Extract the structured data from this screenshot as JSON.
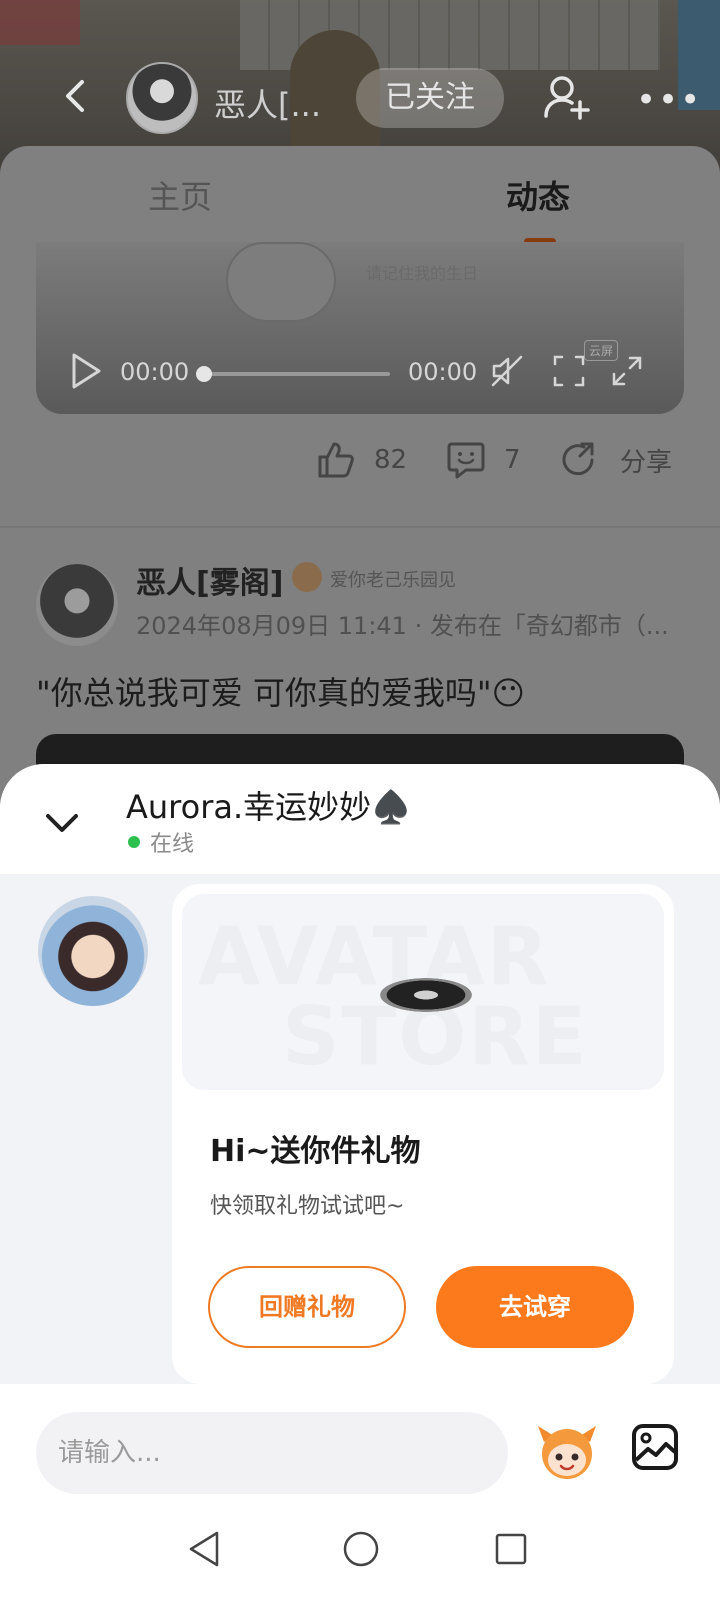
{
  "header": {
    "user_name": "恶人[...",
    "follow_label": "已关注"
  },
  "tabs": [
    {
      "label": "主页"
    },
    {
      "label": "动态"
    }
  ],
  "video": {
    "caption": "请记住我的生日",
    "cc_badge": "云屏",
    "time_current": "00:00",
    "time_total": "00:00",
    "progress": 0
  },
  "actions": {
    "likes": "82",
    "comments": "7",
    "share_label": "分享"
  },
  "post": {
    "author": "恶人[雾阁]",
    "badge_text": "爱你老己乐园见",
    "meta": "2024年08月09日 11:41 · 发布在「奇幻都市（...",
    "text": "\"你总说我可爱  可你真的爱我吗\"😶"
  },
  "chat": {
    "title": "Aurora.幸运妙妙♠️",
    "status": "在线",
    "gift_card": {
      "banner_line1": "AVATAR",
      "banner_line2": "STORE",
      "title": "Hi~送你件礼物",
      "subtitle": "快领取礼物试试吧~",
      "return_label": "回赠礼物",
      "try_label": "去试穿"
    },
    "input_placeholder": "请输入..."
  },
  "colors": {
    "accent": "#fd7a1c",
    "online": "#2ec04f"
  },
  "icons": [
    "back-icon",
    "add-friend-icon",
    "more-icon",
    "play-icon",
    "mute-icon",
    "pip-icon",
    "fullscreen-icon",
    "like-icon",
    "comment-icon",
    "share-icon",
    "chevron-down-icon",
    "emoji-mascot-icon",
    "image-icon",
    "nav-back-icon",
    "nav-home-icon",
    "nav-recent-icon"
  ]
}
